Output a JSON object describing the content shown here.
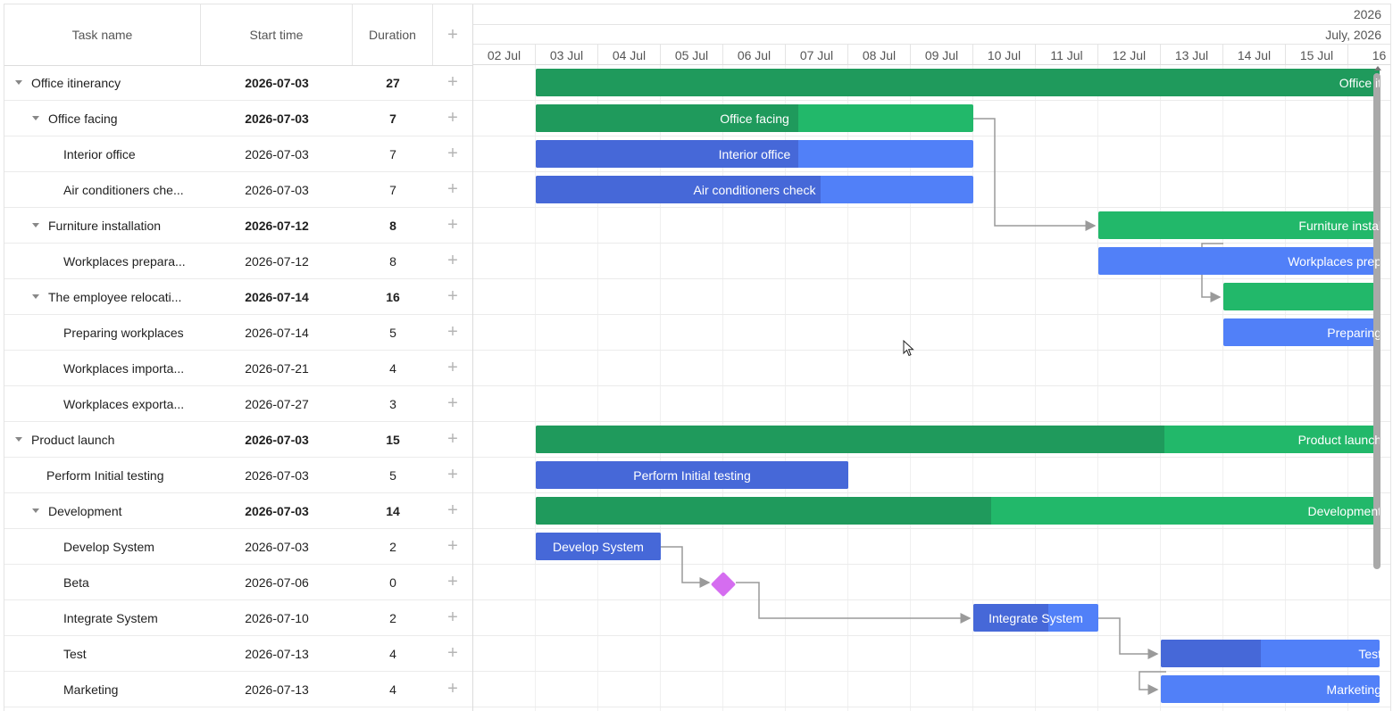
{
  "grid": {
    "columns": {
      "name": "Task name",
      "start": "Start time",
      "duration": "Duration",
      "add": "+"
    },
    "rows": [
      {
        "name": "Office itinerancy",
        "start": "2026-07-03",
        "duration": "27",
        "level": 0,
        "group": true
      },
      {
        "name": "Office facing",
        "start": "2026-07-03",
        "duration": "7",
        "level": 1,
        "group": true
      },
      {
        "name": "Interior office",
        "start": "2026-07-03",
        "duration": "7",
        "level": 2,
        "group": false
      },
      {
        "name": "Air conditioners che...",
        "start": "2026-07-03",
        "duration": "7",
        "level": 2,
        "group": false
      },
      {
        "name": "Furniture installation",
        "start": "2026-07-12",
        "duration": "8",
        "level": 1,
        "group": true
      },
      {
        "name": "Workplaces prepara...",
        "start": "2026-07-12",
        "duration": "8",
        "level": 2,
        "group": false
      },
      {
        "name": "The employee relocati...",
        "start": "2026-07-14",
        "duration": "16",
        "level": 1,
        "group": true
      },
      {
        "name": "Preparing workplaces",
        "start": "2026-07-14",
        "duration": "5",
        "level": 2,
        "group": false
      },
      {
        "name": "Workplaces importa...",
        "start": "2026-07-21",
        "duration": "4",
        "level": 2,
        "group": false
      },
      {
        "name": "Workplaces exporta...",
        "start": "2026-07-27",
        "duration": "3",
        "level": 2,
        "group": false
      },
      {
        "name": "Product launch",
        "start": "2026-07-03",
        "duration": "15",
        "level": 0,
        "group": true
      },
      {
        "name": "Perform Initial testing",
        "start": "2026-07-03",
        "duration": "5",
        "level": 1,
        "group": false
      },
      {
        "name": "Development",
        "start": "2026-07-03",
        "duration": "14",
        "level": 1,
        "group": true
      },
      {
        "name": "Develop System",
        "start": "2026-07-03",
        "duration": "2",
        "level": 2,
        "group": false
      },
      {
        "name": "Beta",
        "start": "2026-07-06",
        "duration": "0",
        "level": 2,
        "group": false
      },
      {
        "name": "Integrate System",
        "start": "2026-07-10",
        "duration": "2",
        "level": 2,
        "group": false
      },
      {
        "name": "Test",
        "start": "2026-07-13",
        "duration": "4",
        "level": 2,
        "group": false
      },
      {
        "name": "Marketing",
        "start": "2026-07-13",
        "duration": "4",
        "level": 2,
        "group": false
      }
    ]
  },
  "scale": {
    "year": "2026",
    "month": "July, 2026",
    "days": [
      "02 Jul",
      "03 Jul",
      "04 Jul",
      "05 Jul",
      "06 Jul",
      "07 Jul",
      "08 Jul",
      "09 Jul",
      "10 Jul",
      "11 Jul",
      "12 Jul",
      "13 Jul",
      "14 Jul",
      "15 Jul",
      "16"
    ]
  },
  "bars": [
    {
      "row": 0,
      "label": "Office it",
      "kind": "project",
      "progress": 0.8
    },
    {
      "row": 1,
      "label": "Office facing",
      "kind": "project",
      "progress": 0.6
    },
    {
      "row": 2,
      "label": "Interior office",
      "kind": "task",
      "progress": 0.6
    },
    {
      "row": 3,
      "label": "Air conditioners check",
      "kind": "task",
      "progress": 0.65
    },
    {
      "row": 4,
      "label": "Furniture instal",
      "kind": "project",
      "progress": 0
    },
    {
      "row": 5,
      "label": "Workplaces prep",
      "kind": "task",
      "progress": 0
    },
    {
      "row": 6,
      "label": "",
      "kind": "project",
      "progress": 0
    },
    {
      "row": 7,
      "label": "Preparing",
      "kind": "task",
      "progress": 0
    },
    {
      "row": 10,
      "label": "Product launch",
      "kind": "project",
      "progress": 0.67
    },
    {
      "row": 11,
      "label": "Perform Initial testing",
      "kind": "task",
      "progress": 1
    },
    {
      "row": 12,
      "label": "Development",
      "kind": "project",
      "progress": 0.52
    },
    {
      "row": 13,
      "label": "Develop System",
      "kind": "task",
      "progress": 1
    },
    {
      "row": 15,
      "label": "Integrate System",
      "kind": "task",
      "progress": 0.6
    },
    {
      "row": 16,
      "label": "Test",
      "kind": "task",
      "progress": 0.4
    },
    {
      "row": 17,
      "label": "Marketing",
      "kind": "task",
      "progress": 0
    }
  ],
  "colors": {
    "project": "#22b86a",
    "project_progress": "#1f9a5c",
    "task": "#5180f8",
    "task_progress": "#4668d8",
    "milestone": "#d56df0",
    "link": "#9a9a9a"
  }
}
